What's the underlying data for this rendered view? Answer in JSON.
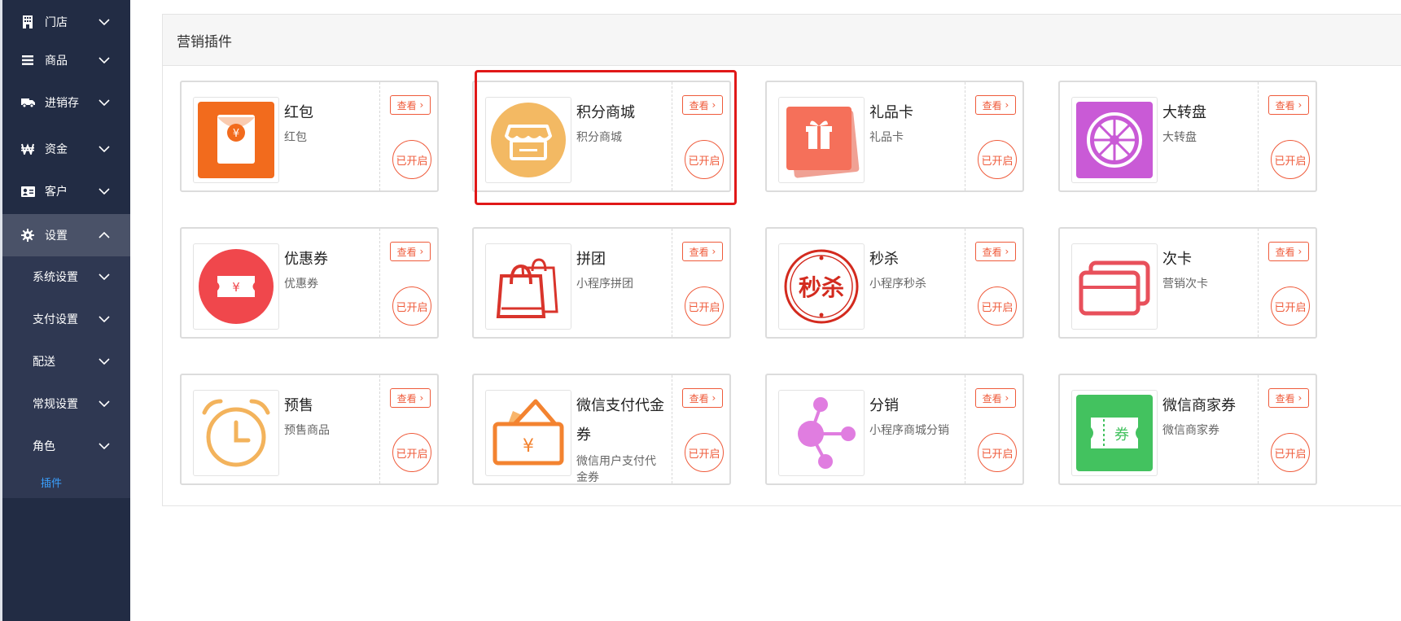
{
  "sidebar": {
    "items": [
      {
        "label": "门店",
        "icon": "building-icon"
      },
      {
        "label": "商品",
        "icon": "list-icon"
      },
      {
        "label": "进销存",
        "icon": "truck-icon"
      },
      {
        "label": "资金",
        "icon": "won-icon"
      },
      {
        "label": "客户",
        "icon": "id-card-icon"
      },
      {
        "label": "设置",
        "icon": "gear-icon",
        "expanded": true
      }
    ],
    "sub_items": [
      {
        "label": "系统设置"
      },
      {
        "label": "支付设置"
      },
      {
        "label": "配送"
      },
      {
        "label": "常规设置"
      },
      {
        "label": "角色"
      }
    ],
    "active_leaf": "插件"
  },
  "panel": {
    "title": "营销插件"
  },
  "plugins": [
    {
      "title": "红包",
      "desc": "红包",
      "view_label": "查看",
      "status_label": "已开启",
      "icon": "red-envelope-icon",
      "color": "#f26b1d"
    },
    {
      "title": "积分商城",
      "desc": "积分商城",
      "view_label": "查看",
      "status_label": "已开启",
      "icon": "store-icon",
      "color": "#f3b963",
      "highlighted": true
    },
    {
      "title": "礼品卡",
      "desc": "礼品卡",
      "view_label": "查看",
      "status_label": "已开启",
      "icon": "gift-card-icon",
      "color": "#f5705a"
    },
    {
      "title": "大转盘",
      "desc": "大转盘",
      "view_label": "查看",
      "status_label": "已开启",
      "icon": "wheel-icon",
      "color": "#c95ad6"
    },
    {
      "title": "优惠券",
      "desc": "优惠券",
      "view_label": "查看",
      "status_label": "已开启",
      "icon": "coupon-icon",
      "color": "#f0474c"
    },
    {
      "title": "拼团",
      "desc": "小程序拼团",
      "view_label": "查看",
      "status_label": "已开启",
      "icon": "shopping-bag-icon",
      "color": "#d9342b"
    },
    {
      "title": "秒杀",
      "desc": "小程序秒杀",
      "view_label": "查看",
      "status_label": "已开启",
      "icon": "flash-sale-icon",
      "color": "#d32a1e",
      "icon_text": "秒杀"
    },
    {
      "title": "次卡",
      "desc": "营销次卡",
      "view_label": "查看",
      "status_label": "已开启",
      "icon": "cards-icon",
      "color": "#e8505b"
    },
    {
      "title": "预售",
      "desc": "预售商品",
      "view_label": "查看",
      "status_label": "已开启",
      "icon": "alarm-clock-icon",
      "color": "#f3b35c"
    },
    {
      "title": "微信支付代金券",
      "desc": "微信用户支付代金券",
      "view_label": "查看",
      "status_label": "已开启",
      "icon": "wallet-voucher-icon",
      "color": "#f38330",
      "icon_text": "¥"
    },
    {
      "title": "分销",
      "desc": "小程序商城分销",
      "view_label": "查看",
      "status_label": "已开启",
      "icon": "distribution-icon",
      "color": "#e07de0"
    },
    {
      "title": "微信商家券",
      "desc": "微信商家券",
      "view_label": "查看",
      "status_label": "已开启",
      "icon": "merchant-coupon-icon",
      "color": "#43c25f",
      "icon_text": "券"
    }
  ]
}
